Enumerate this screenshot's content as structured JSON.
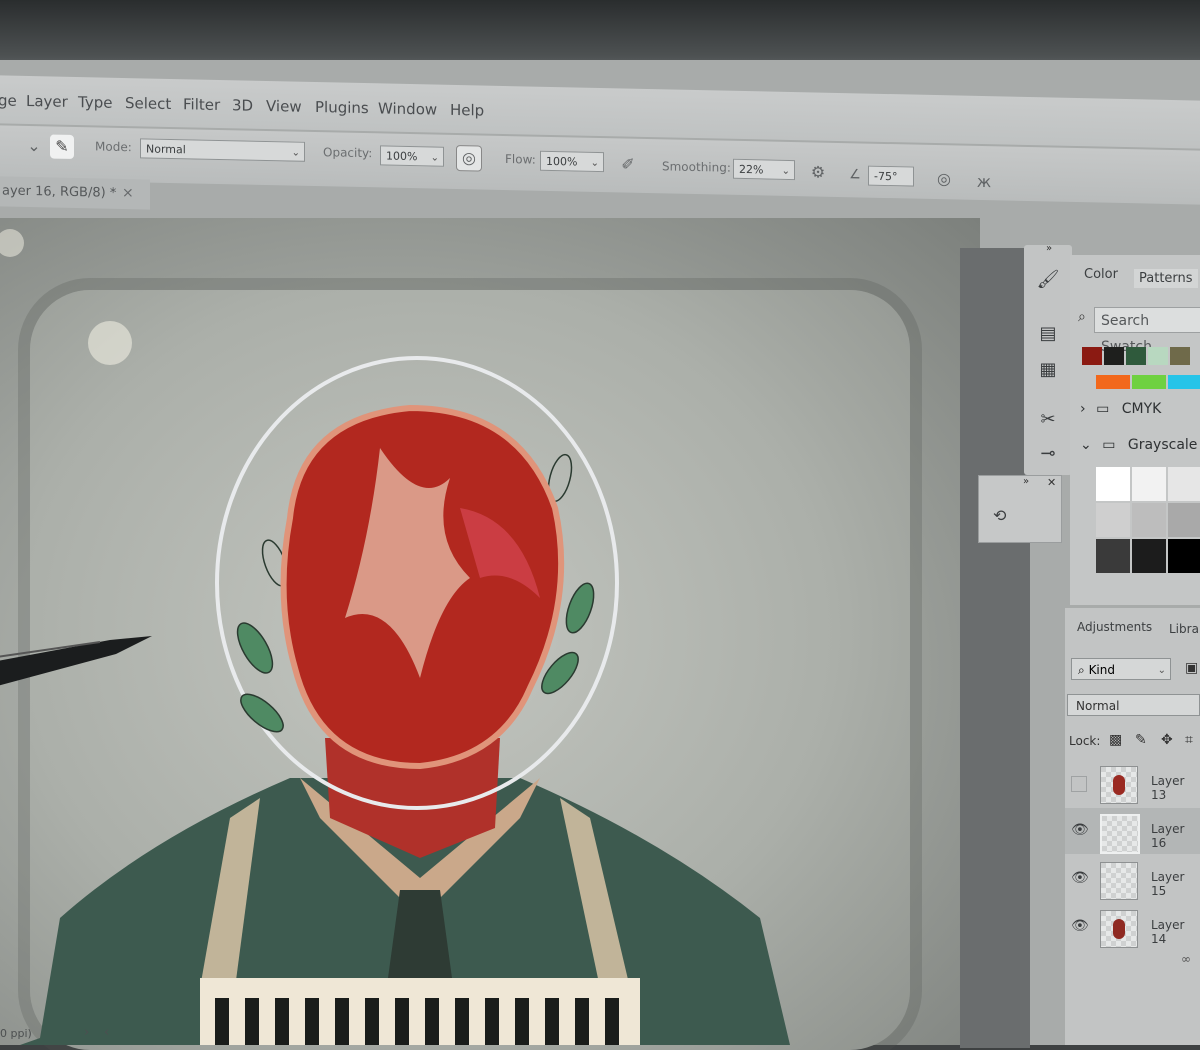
{
  "menu": {
    "items": [
      "ge",
      "Layer",
      "Type",
      "Select",
      "Filter",
      "3D",
      "View",
      "Plugins",
      "Window",
      "Help"
    ]
  },
  "options": {
    "mode_label": "Mode:",
    "mode_value": "Normal",
    "opacity_label": "Opacity:",
    "opacity_value": "100%",
    "flow_label": "Flow:",
    "flow_value": "100%",
    "smoothing_label": "Smoothing:",
    "smoothing_value": "22%",
    "angle_value": "-75°"
  },
  "document": {
    "tab_label": "ayer 16, RGB/8) *",
    "close_glyph": "×"
  },
  "swatches_panel": {
    "tabs": [
      "Color",
      "Patterns"
    ],
    "search_placeholder": "Search Swatch",
    "groups": [
      "CMYK",
      "Grayscale"
    ],
    "swatch_colors_row1": [
      "#8b1a12",
      "#1e1f1d",
      "#2f5a3c",
      "#b8d8c0",
      "#6f6a4a"
    ],
    "swatch_colors_row2": [
      "#f2681c",
      "#6fd140",
      "#26c4e8"
    ],
    "grayscale_colors": [
      "#ffffff",
      "#f2f2f2",
      "#e6e6e6",
      "#cfcfcf",
      "#bdbdbd",
      "#a9a9a9",
      "#3a3a3a",
      "#1c1c1c",
      "#000000"
    ]
  },
  "layers_panel": {
    "tabs": [
      "Adjustments",
      "Libra"
    ],
    "filter_label": "Kind",
    "blend_mode": "Normal",
    "lock_label": "Lock:",
    "layers": [
      {
        "name": "Layer 13",
        "visible": false
      },
      {
        "name": "Layer 16",
        "visible": true
      },
      {
        "name": "Layer 15",
        "visible": true
      },
      {
        "name": "Layer 14",
        "visible": true
      }
    ]
  },
  "status_bar": {
    "text": "0 ppi)"
  }
}
